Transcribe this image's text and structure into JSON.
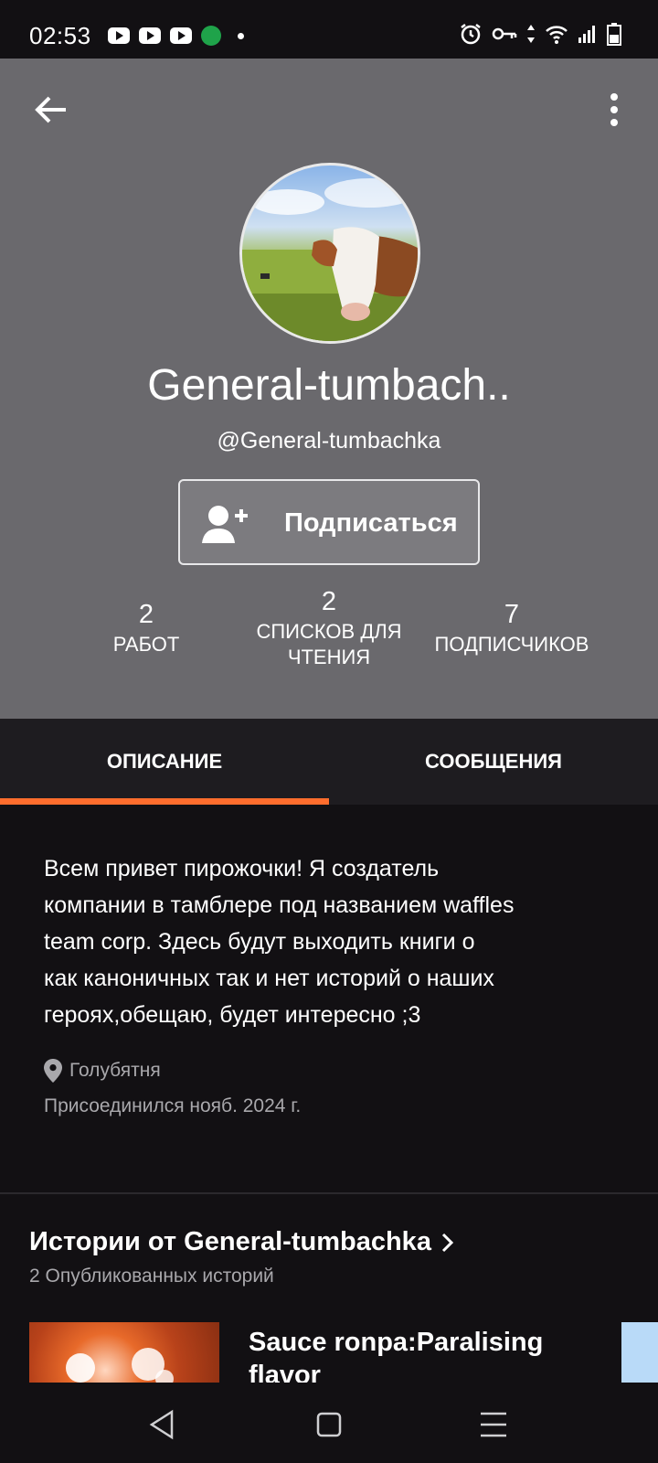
{
  "status_bar": {
    "time": "02:53",
    "left_icons": [
      "youtube-icon",
      "youtube-icon",
      "youtube-icon",
      "app-notification-icon",
      "dot-icon"
    ],
    "right_icons": [
      "alarm-icon",
      "key-icon",
      "data-arrows-icon",
      "wifi-icon",
      "signal-icon",
      "battery-icon"
    ]
  },
  "profile": {
    "display_name": "General-tumbach..",
    "username": "@General-tumbachka",
    "follow_label": "Подписаться",
    "stats": [
      {
        "value": "2",
        "label": "РАБОТ"
      },
      {
        "value": "2",
        "label_line1": "СПИСКОВ ДЛЯ",
        "label_line2": "ЧТЕНИЯ"
      },
      {
        "value": "7",
        "label": "ПОДПИСЧИКОВ"
      }
    ]
  },
  "tabs": [
    {
      "label": "ОПИСАНИЕ",
      "active": true
    },
    {
      "label": "СООБЩЕНИЯ",
      "active": false
    }
  ],
  "about": {
    "lines": [
      "Всем привет пирожочки! Я создатель",
      "компании в тамблере под названием waffles",
      "team corp. Здесь будут выходить книги о",
      "как каноничных так и нет историй о наших",
      "героях,обещаю, будет интересно ;3"
    ],
    "location": "Голубятня",
    "joined": "Присоединился нояб. 2024 г."
  },
  "stories": {
    "title": "Истории от General-tumbachka",
    "subtitle": "2 Опубликованных историй",
    "items": [
      {
        "title_line1": "Sauce ronpa:Paralising",
        "title_line2": "flavor"
      }
    ]
  },
  "colors": {
    "header_bg": "#6a696d",
    "page_bg": "#121013",
    "tab_bg": "#1e1c20",
    "accent": "#ff6d2d"
  }
}
